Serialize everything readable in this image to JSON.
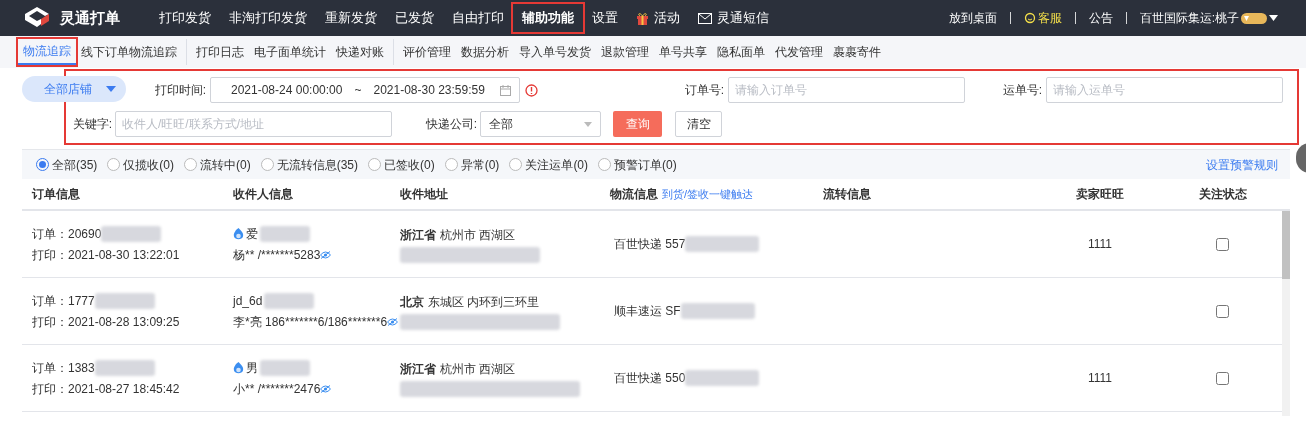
{
  "nav": {
    "brand": "灵通打单",
    "items": [
      {
        "label": "打印发货",
        "highlighted": false
      },
      {
        "label": "非淘打印发货",
        "highlighted": false
      },
      {
        "label": "重新发货",
        "highlighted": false
      },
      {
        "label": "已发货",
        "highlighted": false
      },
      {
        "label": "自由打印",
        "highlighted": false
      },
      {
        "label": "辅助功能",
        "highlighted": true
      },
      {
        "label": "设置",
        "highlighted": false
      },
      {
        "label": "活动",
        "kind": "gift",
        "highlighted": false
      },
      {
        "label": "灵通短信",
        "kind": "mail",
        "highlighted": false
      }
    ],
    "right": [
      {
        "label": "放到桌面",
        "kind": "link"
      },
      {
        "label": "客服",
        "kind": "service"
      },
      {
        "label": "公告",
        "kind": "link"
      },
      {
        "label": "百世国际集运:桃子",
        "kind": "user"
      }
    ]
  },
  "subnav": [
    [
      {
        "label": "物流追踪",
        "selected": true,
        "highlighted": true
      },
      {
        "label": "线下订单物流追踪",
        "selected": false,
        "highlighted": false
      }
    ],
    [
      {
        "label": "打印日志",
        "selected": false,
        "highlighted": false
      },
      {
        "label": "电子面单统计",
        "selected": false,
        "highlighted": false
      },
      {
        "label": "快递对账",
        "selected": false,
        "highlighted": false
      }
    ],
    [
      {
        "label": "评价管理",
        "selected": false,
        "highlighted": false
      },
      {
        "label": "数据分析",
        "selected": false,
        "highlighted": false
      },
      {
        "label": "导入单号发货",
        "selected": false,
        "highlighted": false
      },
      {
        "label": "退款管理",
        "selected": false,
        "highlighted": false
      },
      {
        "label": "单号共享",
        "selected": false,
        "highlighted": false
      },
      {
        "label": "隐私面单",
        "selected": false,
        "highlighted": false
      },
      {
        "label": "代发管理",
        "selected": false,
        "highlighted": false
      },
      {
        "label": "裹裹寄件",
        "selected": false,
        "highlighted": false
      }
    ]
  ],
  "filters": {
    "highlighted": true,
    "shop": "全部店铺",
    "print_time": {
      "label": "打印时间:",
      "start": "2021-08-24 00:00:00",
      "separator": "~",
      "end": "2021-08-30 23:59:59"
    },
    "order_no": {
      "label": "订单号:",
      "placeholder": "请输入订单号"
    },
    "waybill_no": {
      "label": "运单号:",
      "placeholder": "请输入运单号"
    },
    "keyword": {
      "label": "关键字:",
      "placeholder": "收件人/旺旺/联系方式/地址"
    },
    "courier": {
      "label": "快递公司:",
      "value": "全部"
    },
    "buttons": [
      "查询",
      "清空"
    ]
  },
  "status_tabs": [
    {
      "label": "全部(35)",
      "selected": true
    },
    {
      "label": "仅揽收(0)",
      "selected": false
    },
    {
      "label": "流转中(0)",
      "selected": false
    },
    {
      "label": "无流转信息(35)",
      "selected": false
    },
    {
      "label": "已签收(0)",
      "selected": false
    },
    {
      "label": "异常(0)",
      "selected": false
    },
    {
      "label": "关注运单(0)",
      "selected": false
    },
    {
      "label": "预警订单(0)",
      "selected": false
    }
  ],
  "alert_rule_link": "设置预警规则",
  "table": {
    "columns": [
      "订单信息",
      "收件人信息",
      "收件地址",
      "物流信息",
      "流转信息",
      "卖家旺旺",
      "关注状态"
    ],
    "logistics_link": "到货/签收一键触达",
    "rows": [
      {
        "order": "订单：20690",
        "printed": "打印：2021-08-30 13:22:01",
        "buyer": "爱",
        "wangwang": true,
        "receiver": "杨** /*******5283",
        "province": "浙江省",
        "city": "杭州市 西湖区",
        "logistics": "百世快递 557",
        "seller": "1111",
        "followed": false
      },
      {
        "order": "订单：1777",
        "printed": "打印：2021-08-28 13:09:25",
        "buyer": "jd_6d",
        "wangwang": false,
        "receiver": "李*亮 186*******6/186*******6",
        "province": "北京",
        "city": "东城区 内环到三环里",
        "logistics": "顺丰速运 SF",
        "seller": "",
        "followed": false
      },
      {
        "order": "订单：1383",
        "printed": "打印：2021-08-27 18:45:42",
        "buyer": "男",
        "wangwang": true,
        "receiver": "小** /*******2476",
        "province": "浙江省",
        "city": "杭州市 西湖区",
        "logistics": "百世快递 550",
        "seller": "1111",
        "followed": false
      }
    ]
  }
}
